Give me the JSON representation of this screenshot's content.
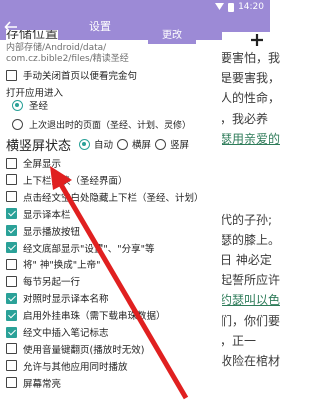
{
  "status": {
    "time": "14:20"
  },
  "reader": {
    "lines": [
      "要害怕，我",
      "是要害我，",
      "人的性命，",
      "，我必养",
      "瑟用亲爱的",
      "",
      "",
      "",
      "代的子孙;",
      "瑟的膝上。",
      "日 神必定",
      "起誓所应许",
      "约瑟叫以色",
      "们，你们要",
      "，正一",
      "收险在棺材"
    ],
    "hl_line_index": [
      4,
      12
    ]
  },
  "panel": {
    "title": "设置",
    "dir_title": "存储位置",
    "change_btn": "更改",
    "path_lines": [
      "内部存储/Android/data/",
      "com.cz.bible2/files/精读圣经"
    ],
    "manual_label": "手动关闭首页以便看完金句",
    "open_section": "打开应用进入",
    "open_options": [
      {
        "label": "圣经",
        "selected": true
      },
      {
        "label": "上次退出时的页面（圣经、计划、灵修）",
        "selected": false
      }
    ],
    "orientation": {
      "label": "横竖屏状态",
      "options": [
        {
          "label": "自动",
          "selected": true
        },
        {
          "label": "横屏",
          "selected": false
        },
        {
          "label": "竖屏",
          "selected": false
        }
      ]
    },
    "options": [
      {
        "label": "全屏显示",
        "checked": false
      },
      {
        "label": "上下栏互换（圣经界面）",
        "checked": false
      },
      {
        "label": "点击经文空白处隐藏上下栏（圣经、计划）",
        "checked": false
      },
      {
        "label": "显示译本栏",
        "checked": true
      },
      {
        "label": "显示播放按钮",
        "checked": true
      },
      {
        "label": "经文底部显示\"设置\"、\"分享\"等",
        "checked": true
      },
      {
        "label": "将\" 神\"换成\"上帝\"",
        "checked": false
      },
      {
        "label": "每节另起一行",
        "checked": false
      },
      {
        "label": "对照时显示译本名称",
        "checked": true
      },
      {
        "label": "启用外挂串珠（需下载串珠数据）",
        "checked": true
      },
      {
        "label": "经文中插入笔记标志",
        "checked": true
      },
      {
        "label": "使用音量键翻页(播放时无效)",
        "checked": false
      },
      {
        "label": "允许与其他应用同时播放",
        "checked": false
      },
      {
        "label": "屏幕常亮",
        "checked": false
      }
    ]
  }
}
